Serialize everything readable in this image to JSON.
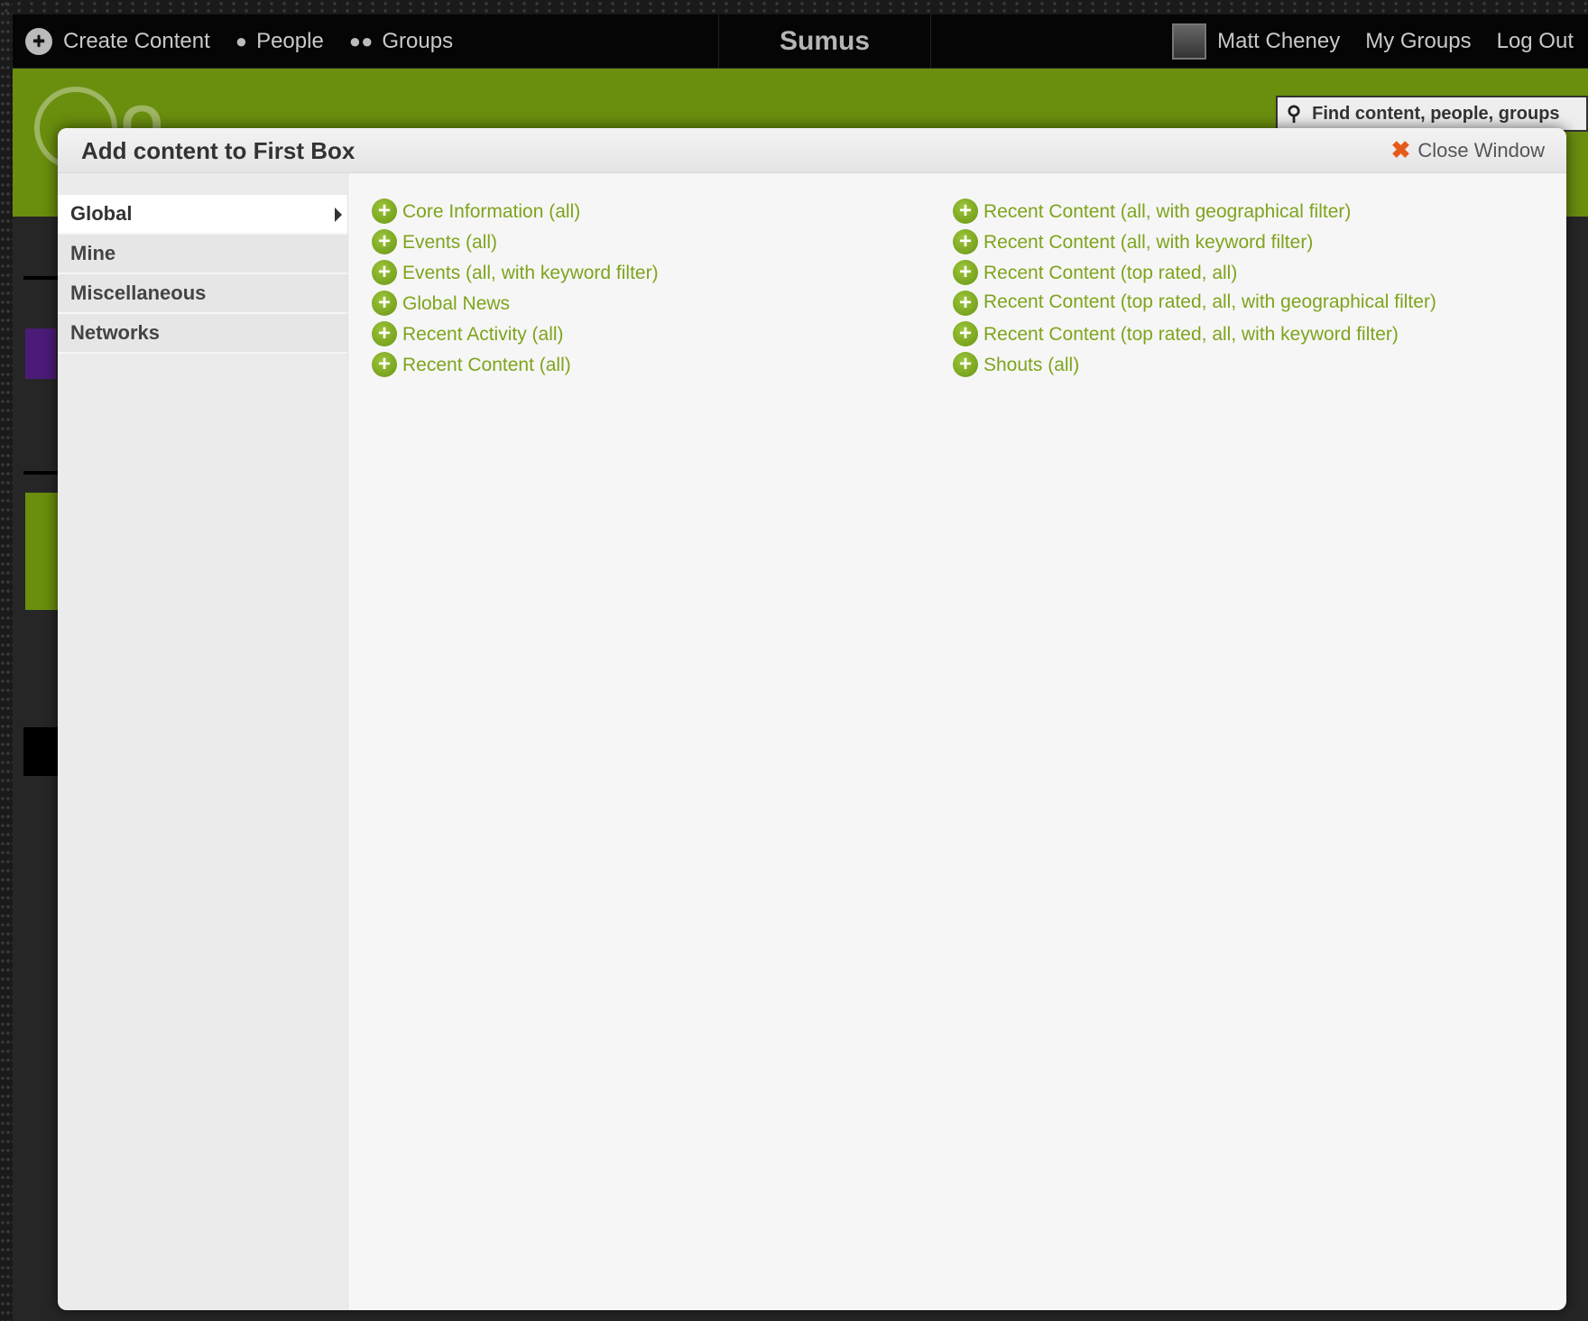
{
  "topbar": {
    "create_content": "Create Content",
    "people": "People",
    "groups": "Groups",
    "site_name": "Sumus",
    "user_name": "Matt Cheney",
    "my_groups": "My Groups",
    "log_out": "Log Out"
  },
  "search": {
    "placeholder": "Find content, people, groups"
  },
  "modal": {
    "title": "Add content to First Box",
    "close_label": "Close Window",
    "categories": [
      {
        "label": "Global"
      },
      {
        "label": "Mine"
      },
      {
        "label": "Miscellaneous"
      },
      {
        "label": "Networks"
      }
    ],
    "column1": [
      "Core Information (all)",
      "Events (all)",
      "Events (all, with keyword filter)",
      "Global News",
      "Recent Activity (all)",
      "Recent Content (all)"
    ],
    "column2": [
      "Recent Content (all, with geographical filter)",
      "Recent Content (all, with keyword filter)",
      "Recent Content (top rated, all)",
      "Recent Content (top rated, all, with geographical filter)",
      "Recent Content (top rated, all, with keyword filter)",
      "Shouts (all)"
    ]
  },
  "colors": {
    "accent_green": "#7ea41c",
    "band_green": "#6a8e0e",
    "close_orange": "#e55a1a"
  }
}
